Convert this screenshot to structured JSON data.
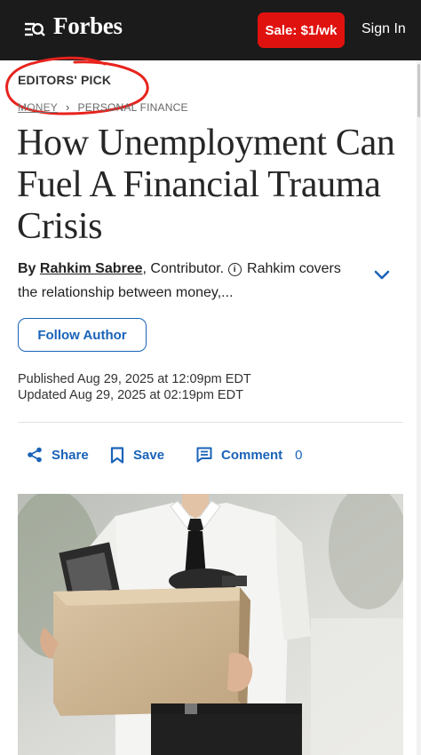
{
  "header": {
    "logo": "Forbes",
    "sale_button": "Sale: $1/wk",
    "sign_in": "Sign In",
    "menu_icon": "menu-search-icon"
  },
  "article": {
    "tag": "EDITORS' PICK",
    "breadcrumb": [
      "MONEY",
      "PERSONAL FINANCE"
    ],
    "headline": "How Unemployment Can Fuel A Financial Trauma Crisis",
    "byline": {
      "by": "By",
      "author": "Rahkim Sabree",
      "role": ", Contributor.",
      "description": "Rahkim covers the relationship between money,..."
    },
    "follow_label": "Follow Author",
    "published": "Published Aug 29, 2025 at 12:09pm EDT",
    "updated": "Updated Aug 29, 2025 at 02:19pm EDT",
    "actions": {
      "share": "Share",
      "save": "Save",
      "comment": "Comment",
      "comment_count": "0"
    },
    "hero_image": "person-holding-cardboard-box-photo"
  },
  "colors": {
    "header_bg": "#1b1b1b",
    "sale_red": "#e0120f",
    "link_blue": "#1a63b8",
    "annotation_red": "#e8231d"
  }
}
